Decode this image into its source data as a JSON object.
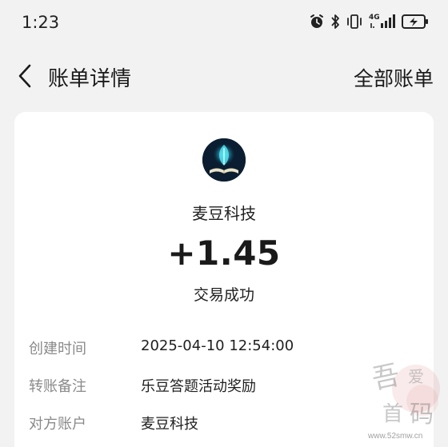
{
  "status_bar": {
    "time": "1:23",
    "network_label": "4G",
    "icons": [
      "alarm-icon",
      "bluetooth-icon",
      "vibrate-icon",
      "signal-icon",
      "battery-charging-icon"
    ]
  },
  "header": {
    "title": "账单详情",
    "right_action": "全部账单",
    "back_icon": "chevron-left-icon"
  },
  "transaction": {
    "merchant_name": "麦豆科技",
    "amount": "+1.45",
    "status": "交易成功",
    "logo_icon": "glowing-book-leaf-logo",
    "details": [
      {
        "label": "创建时间",
        "value": "2025-04-10 12:54:00"
      },
      {
        "label": "转账备注",
        "value": "乐豆答题活动奖励"
      },
      {
        "label": "对方账户",
        "value": "麦豆科技"
      }
    ]
  },
  "watermark": {
    "url": "www.52smw.cn"
  },
  "colors": {
    "page_background": "#f2f2f2",
    "card_background": "#ffffff",
    "label_gray": "#8a8a8a",
    "logo_background": "#0b1d30",
    "logo_glow": "#4fe3f0"
  }
}
